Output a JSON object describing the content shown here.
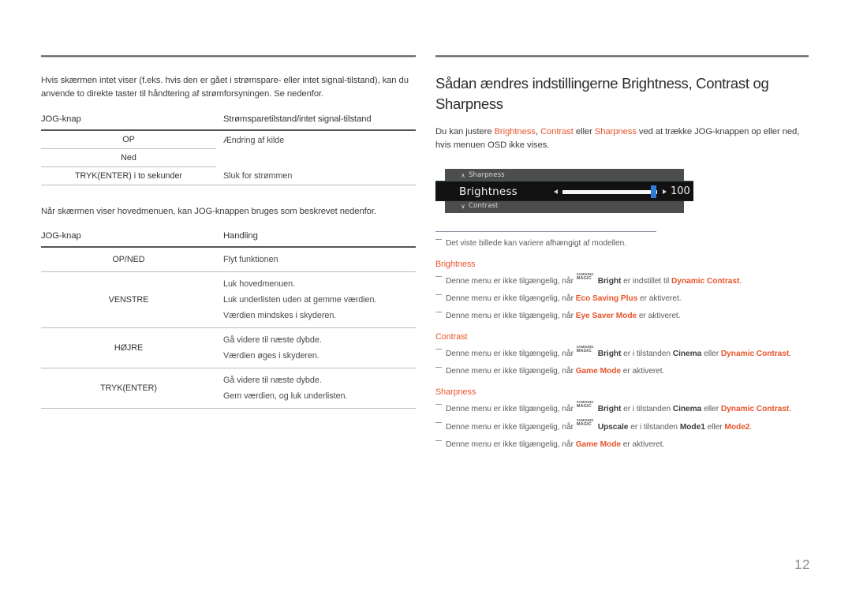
{
  "left": {
    "intro": "Hvis skærmen intet viser (f.eks. hvis den er gået i strømspare- eller intet signal-tilstand), kan du anvende to direkte taster til håndtering af strømforsyningen. Se nedenfor.",
    "table1": {
      "headers": [
        "JOG-knap",
        "Strømsparetilstand/intet signal-tilstand"
      ],
      "rows": [
        {
          "key": "OP",
          "value": "Ændring af kilde"
        },
        {
          "key": "Ned",
          "value": ""
        },
        {
          "key": "TRYK(ENTER) i to sekunder",
          "value": "Sluk for strømmen"
        }
      ]
    },
    "intro2": "Når skærmen viser hovedmenuen, kan JOG-knappen bruges som beskrevet nedenfor.",
    "table2": {
      "headers": [
        "JOG-knap",
        "Handling"
      ],
      "rows": [
        {
          "key": "OP/NED",
          "values": [
            "Flyt funktionen"
          ]
        },
        {
          "key": "VENSTRE",
          "values": [
            "Luk hovedmenuen.",
            "Luk underlisten uden at gemme værdien.",
            "Værdien mindskes i skyderen."
          ]
        },
        {
          "key": "HØJRE",
          "values": [
            "Gå videre til næste dybde.",
            "Værdien øges i skyderen."
          ]
        },
        {
          "key": "TRYK(ENTER)",
          "values": [
            "Gå videre til næste dybde.",
            "Gem værdien, og luk underlisten."
          ]
        }
      ]
    }
  },
  "right": {
    "title": "Sådan ændres indstillingerne Brightness, Contrast og Sharpness",
    "para": {
      "p1": "Du kan justere ",
      "a1": "Brightness",
      "p2": ", ",
      "a2": "Contrast",
      "p3": " eller ",
      "a3": "Sharpness",
      "p4": " ved at trække JOG-knappen op eller ned, hvis menuen OSD ikke vises."
    },
    "osd": {
      "top_item": "Sharpness",
      "bottom_item": "Contrast",
      "selected_item": "Brightness",
      "value": "100",
      "up_chevron": "∧",
      "down_chevron": "∨",
      "knob_color": "#2f7bd8",
      "bar_color": "#f4f4f4",
      "panel_color": "#4d4d4d",
      "selected_color": "#121212"
    },
    "note_model": "Det viste billede kan variere afhængigt af modellen.",
    "sections": [
      {
        "heading": "Brightness",
        "notes": [
          {
            "pre": "Denne menu er ikke tilgængelig, når ",
            "magic": true,
            "magic_top": "SAMSUNG",
            "magic_bot": "MAGIC",
            "bold_dark": "Bright",
            "mid": " er indstillet til ",
            "accent": "Dynamic Contrast",
            "post": "."
          },
          {
            "pre": "Denne menu er ikke tilgængelig, når ",
            "magic": false,
            "accent_first": "Eco Saving Plus",
            "post": " er aktiveret."
          },
          {
            "pre": "Denne menu er ikke tilgængelig, når ",
            "magic": false,
            "accent_first": "Eye Saver Mode",
            "post": " er aktiveret."
          }
        ]
      },
      {
        "heading": "Contrast",
        "notes": [
          {
            "pre": "Denne menu er ikke tilgængelig, når ",
            "magic": true,
            "magic_top": "SAMSUNG",
            "magic_bot": "MAGIC",
            "bold_dark": "Bright",
            "mid": " er i tilstanden ",
            "accent": "Cinema",
            "mid2": " eller ",
            "accent2": "Dynamic Contrast",
            "post": "."
          },
          {
            "pre": "Denne menu er ikke tilgængelig, når ",
            "magic": false,
            "accent_first": "Game Mode",
            "post": " er aktiveret."
          }
        ]
      },
      {
        "heading": "Sharpness",
        "notes": [
          {
            "pre": "Denne menu er ikke tilgængelig, når ",
            "magic": true,
            "magic_top": "SAMSUNG",
            "magic_bot": "MAGIC",
            "bold_dark": "Bright",
            "mid": " er i tilstanden ",
            "accent": "Cinema",
            "mid2": " eller ",
            "accent2": "Dynamic Contrast",
            "post": "."
          },
          {
            "pre": "Denne menu er ikke tilgængelig, når ",
            "magic": true,
            "magic_top": "SAMSUNG",
            "magic_bot": "MAGIC",
            "bold_dark": "Upscale",
            "mid": " er i tilstanden ",
            "accent": "Mode1",
            "mid2": " eller ",
            "accent2": "Mode2",
            "post": "."
          },
          {
            "pre": "Denne menu er ikke tilgængelig, når ",
            "magic": false,
            "accent_first": "Game Mode",
            "post": " er aktiveret."
          }
        ]
      }
    ]
  },
  "page_number": "12"
}
